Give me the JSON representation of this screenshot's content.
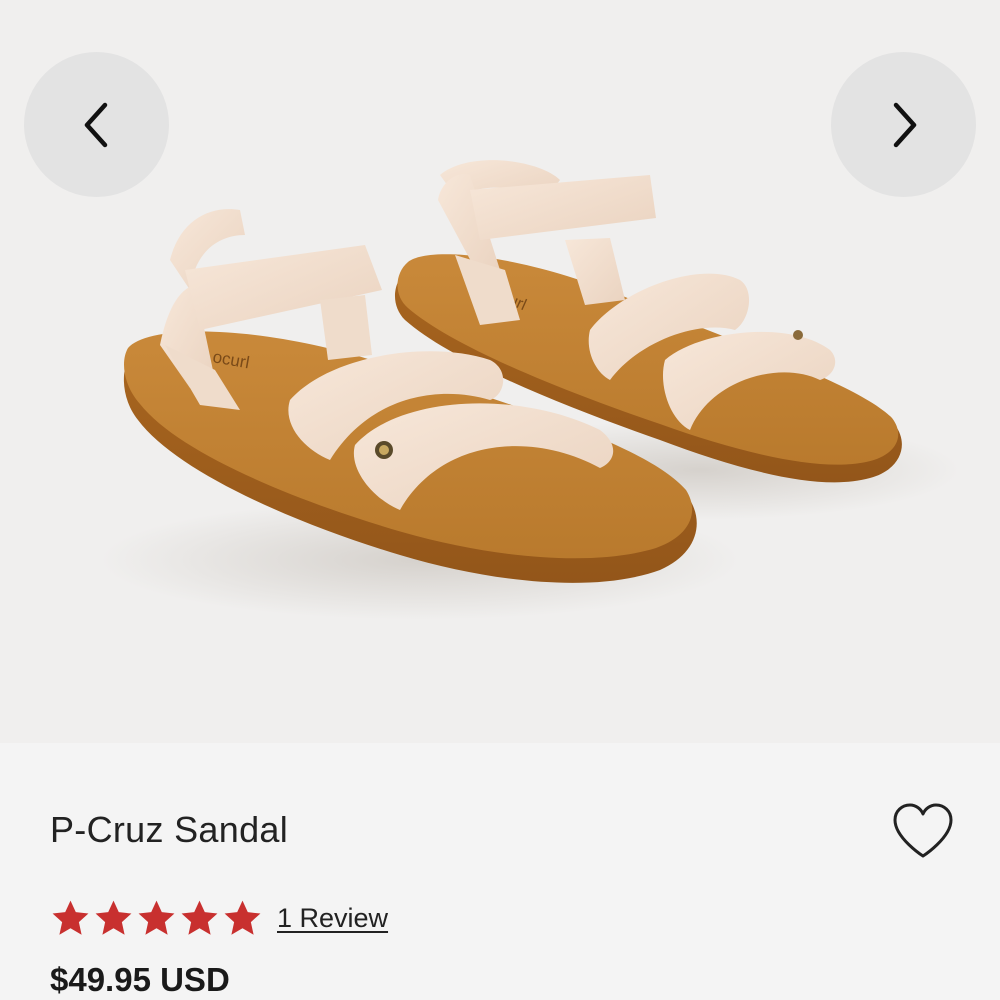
{
  "gallery": {
    "image_alt": "P-Cruz Sandal product photo",
    "prev_icon": "chevron-left-icon",
    "next_icon": "chevron-right-icon",
    "sole_brand_text_left": "ocurl",
    "sole_brand_text_right": "curl"
  },
  "product": {
    "title": "P-Cruz Sandal",
    "wishlist_icon": "heart-outline-icon",
    "rating": {
      "stars": 5,
      "max_stars": 5,
      "star_color": "#c8302f",
      "review_label": "1 Review"
    },
    "price": "$49.95 USD"
  }
}
